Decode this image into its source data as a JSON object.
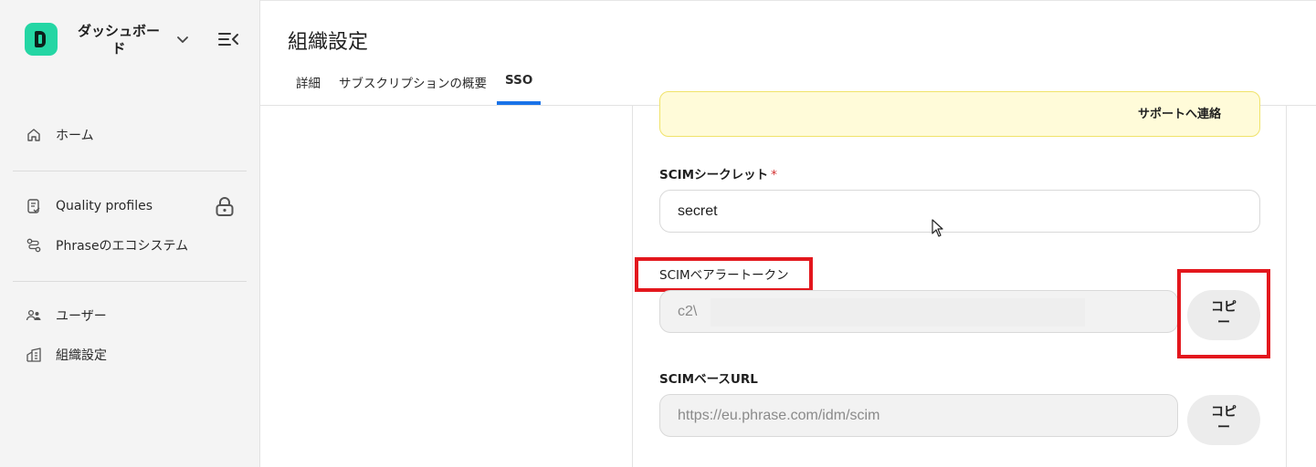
{
  "sidebar": {
    "brand_title": "ダッシュボード",
    "items": [
      {
        "label": "ホーム",
        "icon": "home-icon"
      },
      {
        "label": "Quality profiles",
        "icon": "quality-profile-icon",
        "locked": true
      },
      {
        "label": "Phraseのエコシステム",
        "icon": "ecosystem-icon"
      },
      {
        "label": "ユーザー",
        "icon": "users-icon"
      },
      {
        "label": "組織設定",
        "icon": "organization-icon"
      }
    ]
  },
  "header": {
    "title": "組織設定",
    "tabs": [
      {
        "label": "詳細",
        "active": false
      },
      {
        "label": "サブスクリプションの概要",
        "active": false
      },
      {
        "label": "SSO",
        "active": true
      }
    ]
  },
  "notice": {
    "link_text": "サポートへ連絡"
  },
  "form": {
    "scim_secret": {
      "label": "SCIMシークレット",
      "required_mark": "*",
      "value": "secret"
    },
    "scim_bearer_token": {
      "label": "SCIMベアラートークン",
      "value": "c2\\",
      "copy_label": "コピー"
    },
    "scim_base_url": {
      "label": "SCIMベースURL",
      "value": "https://eu.phrase.com/idm/scim",
      "copy_label": "コピー"
    }
  },
  "colors": {
    "brand": "#24d6a4",
    "tab_active": "#1a73e8",
    "highlight": "#e3171d",
    "notice_bg": "#fffbd9"
  }
}
